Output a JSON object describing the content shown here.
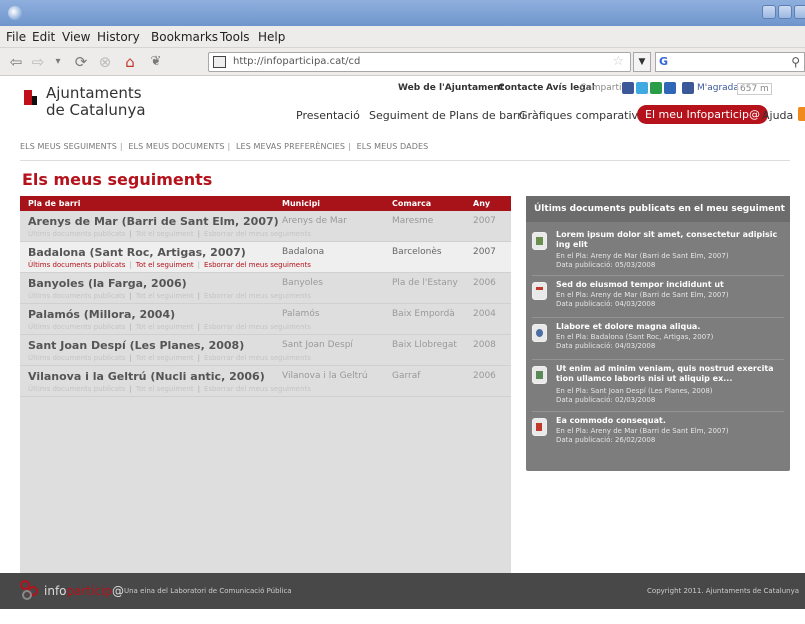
{
  "browser": {
    "menu": [
      "File",
      "Edit",
      "View",
      "History",
      "Bookmarks",
      "Tools",
      "Help"
    ],
    "url": "http://infoparticipa.cat/cd",
    "search_engine": "G"
  },
  "site": {
    "logo_line1": "Ajuntaments",
    "logo_line2": "de Catalunya",
    "top_links": [
      "Web de l'Ajuntament",
      "Contacte",
      "Avís legal"
    ],
    "share_label": "Compartir:",
    "like_label": "M'agrada",
    "like_count": "657 m",
    "nav": [
      "Presentació",
      "Seguiment de Plans de barri",
      "Gràfiques comparatives",
      "El meu Infoparticip@",
      "Ajuda"
    ]
  },
  "tabs": [
    "ELS MEUS SEGUIMENTS",
    "ELS MEUS DOCUMENTS",
    "LES MEVAS PREFERÈNCIES",
    "ELS MEUS DADES"
  ],
  "page_title": "Els meus seguiments",
  "table": {
    "columns": [
      "Pla de barri",
      "Municipi",
      "Comarca",
      "Any"
    ],
    "actions": [
      "Últims documents publicats",
      "Tot el seguiment",
      "Esborrar del meus seguiments"
    ],
    "rows": [
      {
        "name": "Arenys de Mar (Barri de Sant Elm, 2007)",
        "municipi": "Arenys de Mar",
        "comarca": "Maresme",
        "any": "2007"
      },
      {
        "name": "Badalona (Sant Roc, Artigas, 2007)",
        "municipi": "Badalona",
        "comarca": "Barcelonès",
        "any": "2007"
      },
      {
        "name": "Banyoles (la Farga, 2006)",
        "municipi": "Banyoles",
        "comarca": "Pla de l'Estany",
        "any": "2006"
      },
      {
        "name": "Palamós (Millora, 2004)",
        "municipi": "Palamós",
        "comarca": "Baix Empordà",
        "any": "2004"
      },
      {
        "name": "Sant Joan Despí (Les Planes, 2008)",
        "municipi": "Sant Joan Despí",
        "comarca": "Baix Llobregat",
        "any": "2008"
      },
      {
        "name": "Vilanova i la Geltrú (Nucli antic, 2006)",
        "municipi": "Vilanova i la Geltrú",
        "comarca": "Garraf",
        "any": "2006"
      }
    ]
  },
  "panel": {
    "title": "Últims documents publicats en el meu seguiment",
    "items": [
      {
        "title": "Lorem ipsum dolor sit amet, consectetur adipisic ing elit",
        "pla": "En el Pla: Areny de Mar (Barri de Sant Elm, 2007)",
        "date": "Data publicació: 05/03/2008",
        "icon": "document-icon"
      },
      {
        "title": "Sed do eiusmod tempor incididunt ut",
        "pla": "En el Pla: Areny de Mar (Barri de Sant Elm, 2007)",
        "date": "Data publicació: 04/03/2008",
        "icon": "calendar-icon"
      },
      {
        "title": "Llabore et dolore magna aliqua.",
        "pla": "En el Pla: Badalona (Sant Roc, Artigas, 2007)",
        "date": "Data publicació: 04/03/2008",
        "icon": "people-icon"
      },
      {
        "title": "Ut enim ad minim veniam, quis nostrud exercita tion ullamco laboris nisi ut aliquip ex...",
        "pla": "En el Pla: Sant Joan Despí (Les Planes, 2008)",
        "date": "Data publicació: 02/03/2008",
        "icon": "image-icon"
      },
      {
        "title": "Ea commodo consequat.",
        "pla": "En el Pla: Areny de Mar (Barri de Sant Elm, 2007)",
        "date": "Data publicació: 26/02/2008",
        "icon": "pdf-icon"
      }
    ]
  },
  "footer": {
    "brand_a": "info",
    "brand_b": "particip",
    "brand_c": "@",
    "tagline": "Una eina del Laboratori de Comunicació Pública",
    "copyright": "Copyright 2011. Ajuntaments de Catalunya"
  },
  "colors": {
    "accent": "#b5121b",
    "panel": "#7d7d7d",
    "footer": "#484848"
  }
}
